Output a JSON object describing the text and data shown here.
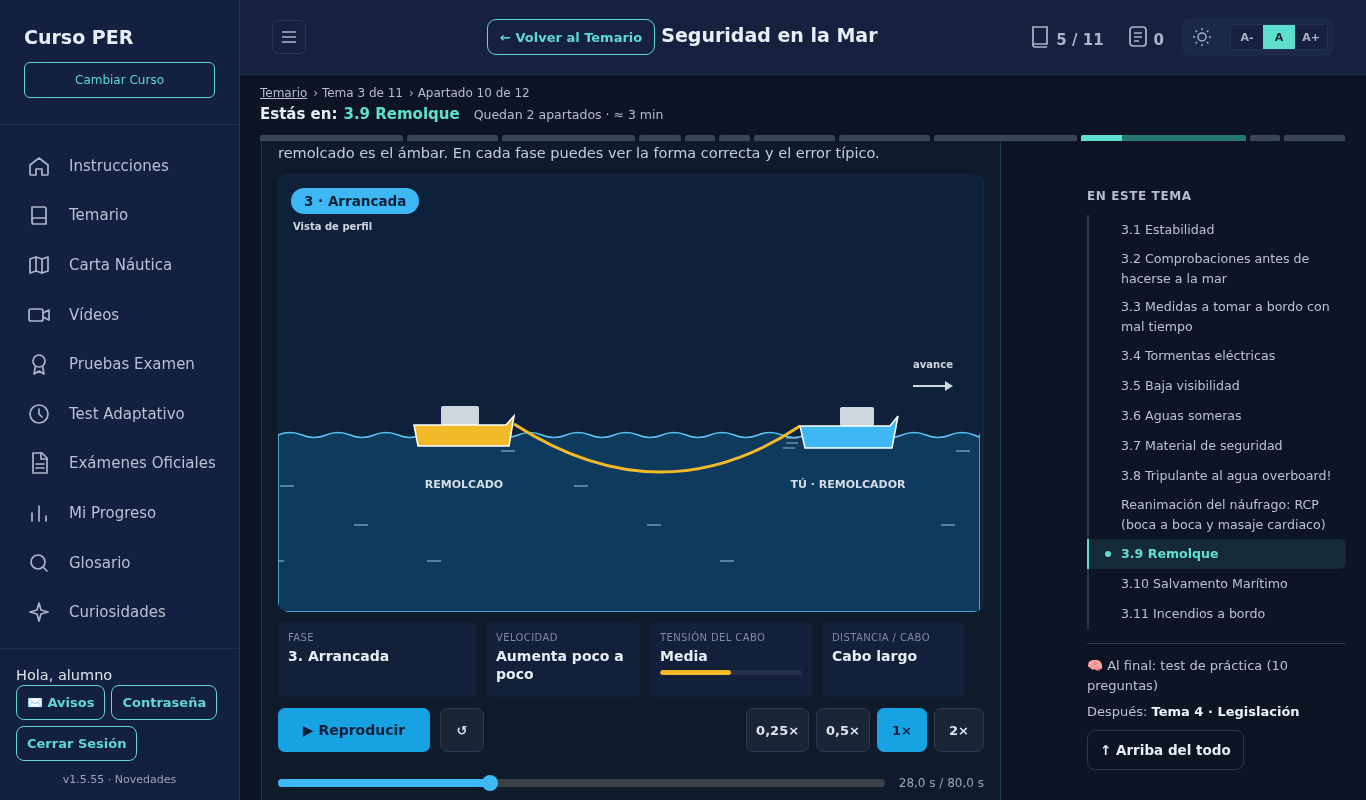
{
  "sidebar": {
    "title": "Curso PER",
    "change_button": "Cambiar Curso",
    "items": [
      {
        "label": "Instrucciones",
        "selected": false
      },
      {
        "label": "Temario",
        "selected": false
      },
      {
        "label": "Carta Náutica",
        "selected": false
      },
      {
        "label": "Vídeos",
        "selected": false
      },
      {
        "label": "Pruebas Examen",
        "selected": false
      },
      {
        "label": "Test Adaptativo",
        "selected": false
      },
      {
        "label": "Exámenes Oficiales",
        "selected": false
      },
      {
        "label": "Mi Progreso",
        "selected": false
      },
      {
        "label": "Glosario",
        "selected": false
      },
      {
        "label": "Curiosidades",
        "selected": false
      }
    ],
    "greeting": "Hola, alumno",
    "buttons": [
      "✉️ Avisos",
      "Contraseña",
      "Cerrar Sesión"
    ],
    "version": "v1.5.55 · Novedades"
  },
  "header": {
    "back_button": "← Volver al Temario",
    "title": "Seguridad en la Mar",
    "topics_count": "5 / 11",
    "notes_count": "0",
    "font_sizes": [
      {
        "label": "A-",
        "selected": false
      },
      {
        "label": "A",
        "selected": true
      },
      {
        "label": "A+",
        "selected": false
      }
    ]
  },
  "breadcrumb": {
    "root": "Temario",
    "topic": "› Tema 3 de 11",
    "section": "› Apartado 10 de 12",
    "here_label": "Estás en:",
    "here": "3.9 Remolque",
    "remaining": "Quedan 2 apartados · ≈ 3 min"
  },
  "progress_segments": [
    {
      "selected": false
    },
    {
      "selected": false
    },
    {
      "selected": false
    },
    {
      "selected": false
    },
    {
      "selected": false
    },
    {
      "selected": false
    },
    {
      "selected": false
    },
    {
      "selected": false
    },
    {
      "selected": false
    },
    {
      "selected": true,
      "level": 0.25
    },
    {
      "selected": false
    },
    {
      "selected": false
    }
  ],
  "intro_text": "remolcado es el ámbar. En cada fase puedes ver la forma correcta y el error típico.",
  "scene": {
    "phase_badge": "3 · Arrancada",
    "view_label": "Vista de perfil",
    "direction_label": "avance",
    "towed_label": "REMOLCADO",
    "tug_label": "TÚ · REMOLCADOR"
  },
  "stats": [
    {
      "kind": "plain",
      "label": "FASE",
      "value": "3. Arrancada"
    },
    {
      "kind": "plain",
      "label": "VELOCIDAD",
      "value": "Aumenta poco a poco"
    },
    {
      "kind": "meter",
      "label": "TENSIÓN DEL CABO",
      "value": "Media",
      "level": 0.5
    },
    {
      "kind": "plain",
      "label": "DISTANCIA / CABO",
      "value": "Cabo largo"
    }
  ],
  "controls": {
    "play_button": "▶ Reproducir",
    "reset_button": "↺",
    "speeds": [
      {
        "label": "0,25×",
        "selected": false
      },
      {
        "label": "0,5×",
        "selected": false
      },
      {
        "label": "1×",
        "selected": true
      },
      {
        "label": "2×",
        "selected": false
      }
    ],
    "timeline": {
      "level": 0.35,
      "reading": "28,0 s / 80,0 s"
    }
  },
  "toc": {
    "heading": "EN ESTE TEMA",
    "items": [
      {
        "label": "3.1 Estabilidad",
        "selected": false
      },
      {
        "label": "3.2 Comprobaciones antes de hacerse a la mar",
        "selected": false
      },
      {
        "label": "3.3 Medidas a tomar a bordo con mal tiempo",
        "selected": false
      },
      {
        "label": "3.4 Tormentas eléctricas",
        "selected": false
      },
      {
        "label": "3.5 Baja visibilidad",
        "selected": false
      },
      {
        "label": "3.6 Aguas someras",
        "selected": false
      },
      {
        "label": "3.7 Material de seguridad",
        "selected": false
      },
      {
        "label": "3.8 Tripulante al agua overboard!",
        "selected": false
      },
      {
        "label": "Reanimación del náufrago: RCP (boca a boca y masaje cardiaco)",
        "selected": false
      },
      {
        "label": "3.9 Remolque",
        "selected": true
      },
      {
        "label": "3.10 Salvamento Marítimo",
        "selected": false
      },
      {
        "label": "3.11 Incendios a bordo",
        "selected": false
      }
    ],
    "final_note": "🧠 Al final: test de práctica (10 preguntas)",
    "next": "Después: **Tema 4 · Legislación**",
    "top_button": "↑ Arriba del todo"
  }
}
